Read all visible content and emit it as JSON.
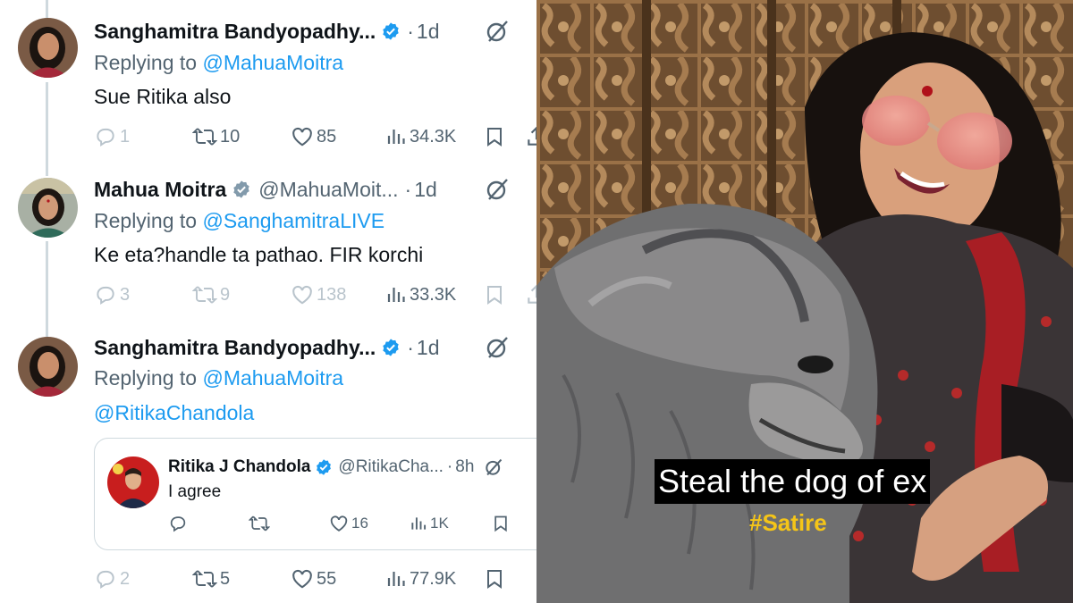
{
  "tweets": [
    {
      "name": "Sanghamitra Bandyopadhy...",
      "handle": "",
      "separator": "·",
      "time": "1d",
      "replying_prefix": "Replying to ",
      "replying_to": "@MahuaMoitra",
      "text": "Sue Ritika also",
      "link_text": "",
      "stats": {
        "replies": "1",
        "reposts": "10",
        "likes": "85",
        "views": "34.3K"
      },
      "avatar_colors": {
        "bg": "#7a5a45",
        "hair": "#1b1410",
        "skin": "#c98f6c",
        "dress": "#a4283a"
      }
    },
    {
      "name": "Mahua Moitra",
      "handle": "@MahuaMoit...",
      "separator": "·",
      "time": "1d",
      "replying_prefix": "Replying to ",
      "replying_to": "@SanghamitraLIVE",
      "text": "Ke eta?handle ta pathao. FIR korchi",
      "link_text": "",
      "stats": {
        "replies": "3",
        "reposts": "9",
        "likes": "138",
        "views": "33.3K"
      },
      "avatar_colors": {
        "bg": "#a8b0a4",
        "hair": "#1d1612",
        "skin": "#d09a78",
        "dress": "#2f6b5a"
      }
    },
    {
      "name": "Sanghamitra Bandyopadhy...",
      "handle": "",
      "separator": "·",
      "time": "1d",
      "replying_prefix": "Replying to ",
      "replying_to": "@MahuaMoitra",
      "text": "",
      "link_text": "@RitikaChandola",
      "stats": {
        "replies": "2",
        "reposts": "5",
        "likes": "55",
        "views": "77.9K"
      },
      "avatar_colors": {
        "bg": "#7a5a45",
        "hair": "#1b1410",
        "skin": "#c98f6c",
        "dress": "#a4283a"
      }
    }
  ],
  "quoted_tweet": {
    "name": "Ritika J Chandola",
    "handle": "@RitikaCha...",
    "separator": "·",
    "time": "8h",
    "text": "I agree",
    "stats": {
      "replies": "",
      "reposts": "",
      "likes": "16",
      "views": "1K"
    }
  },
  "video": {
    "caption": "Steal the dog of ex",
    "tag": "#Satire"
  },
  "colors": {
    "accent": "#1d9bf0",
    "text": "#0f1419",
    "secondary": "#536471",
    "muted": "#b9c4cc",
    "border": "#cfd9de",
    "caption_tag": "#f5c518"
  },
  "icons": [
    "verified-badge-icon",
    "grok-icon",
    "reply-icon",
    "repost-icon",
    "like-icon",
    "views-icon",
    "bookmark-icon",
    "share-icon"
  ]
}
